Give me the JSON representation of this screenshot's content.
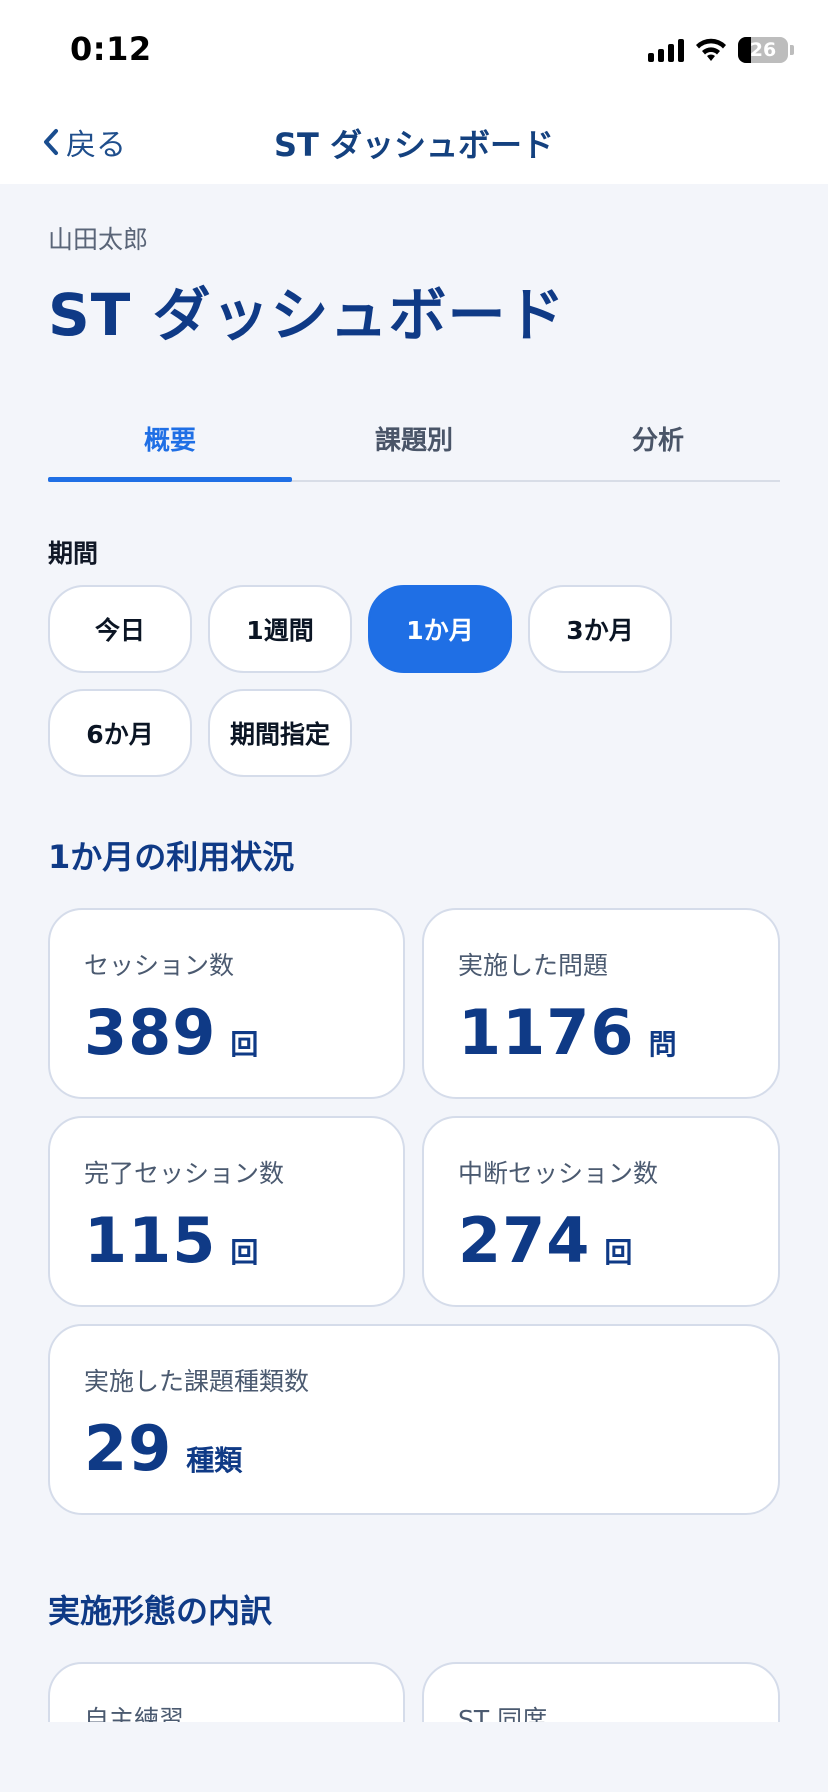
{
  "status_bar": {
    "time": "0:12",
    "battery": "26"
  },
  "nav": {
    "back_label": "戻る",
    "title": "ST ダッシュボード"
  },
  "header": {
    "user_name": "山田太郎",
    "title": "ST ダッシュボード"
  },
  "tabs": [
    {
      "label": "概要",
      "active": true
    },
    {
      "label": "課題別",
      "active": false
    },
    {
      "label": "分析",
      "active": false
    }
  ],
  "period": {
    "label": "期間",
    "options": [
      "今日",
      "1週間",
      "1か月",
      "3か月",
      "6か月",
      "期間指定"
    ],
    "selected": "1か月"
  },
  "usage": {
    "title": "1か月の利用状況",
    "cards": [
      {
        "label": "セッション数",
        "value": "389",
        "unit": "回"
      },
      {
        "label": "実施した問題",
        "value": "1176",
        "unit": "問"
      },
      {
        "label": "完了セッション数",
        "value": "115",
        "unit": "回"
      },
      {
        "label": "中断セッション数",
        "value": "274",
        "unit": "回"
      },
      {
        "label": "実施した課題種類数",
        "value": "29",
        "unit": "種類"
      }
    ]
  },
  "breakdown": {
    "title": "実施形態の内訳",
    "cards": [
      {
        "label": "自主練習"
      },
      {
        "label": "ST 同席"
      }
    ]
  },
  "colors": {
    "accent": "#1f6fe5",
    "heading": "#0f3a86",
    "background": "#f3f5fa"
  }
}
